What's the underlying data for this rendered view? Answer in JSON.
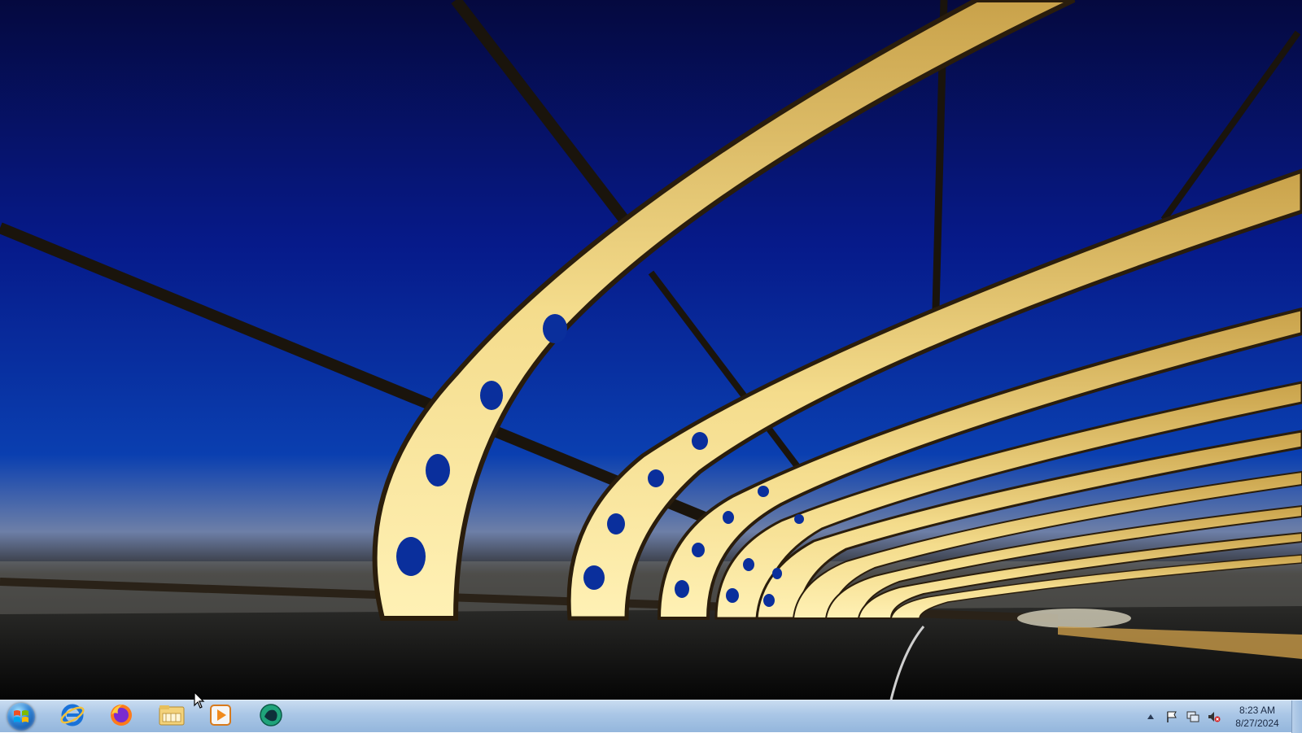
{
  "desktop": {
    "wallpaper": "bridge-tunnel-wallpaper",
    "sky_color_top": "#05093f",
    "sky_color_mid": "#0a3fb0",
    "structure_color": "#f2d27a"
  },
  "taskbar": {
    "start_icon": "windows-start-orb",
    "pinned": [
      {
        "name": "internet-explorer",
        "icon": "ie-icon"
      },
      {
        "name": "firefox",
        "icon": "firefox-icon"
      },
      {
        "name": "file-explorer",
        "icon": "folder-icon"
      },
      {
        "name": "media-player",
        "icon": "media-player-icon"
      },
      {
        "name": "network-app",
        "icon": "green-globe-icon"
      }
    ],
    "tray": {
      "icons": [
        "show-hidden-icons",
        "action-center-flag-icon",
        "network-icon",
        "volume-muted-icon"
      ],
      "time": "8:23 AM",
      "date": "8/27/2024"
    }
  }
}
